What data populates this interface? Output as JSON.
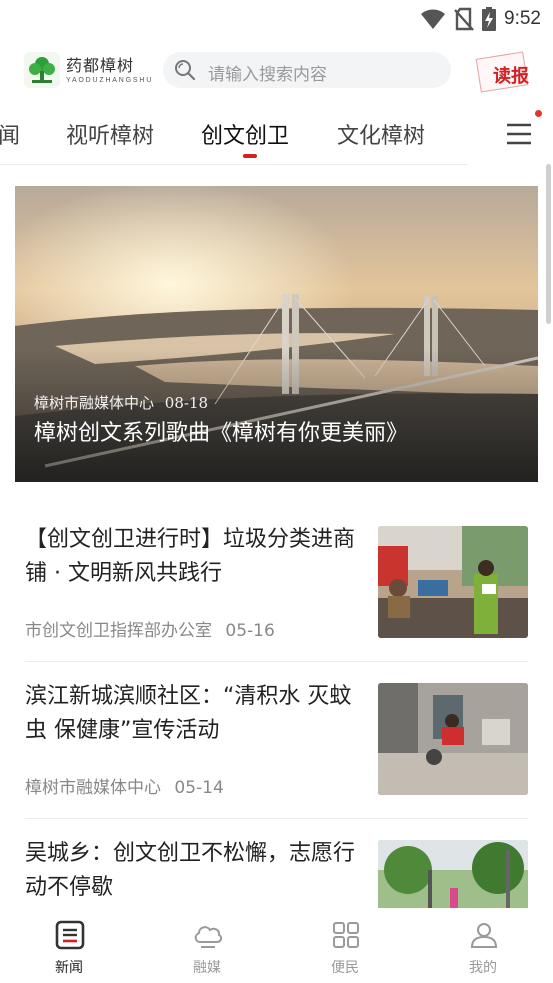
{
  "status_bar": {
    "time": "9:52",
    "icons": [
      "wifi-icon",
      "no-sim-icon",
      "battery-charging-icon"
    ]
  },
  "header": {
    "logo_cn": "药都樟树",
    "logo_en": "YAODUZHANGSHU",
    "search_placeholder": "请输入搜索内容",
    "dubao_label": "读报"
  },
  "tabs": [
    {
      "label": "闻",
      "active": false
    },
    {
      "label": "视听樟树",
      "active": false
    },
    {
      "label": "创文创卫",
      "active": true
    },
    {
      "label": "文化樟树",
      "active": false
    }
  ],
  "hero": {
    "source": "樟树市融媒体中心",
    "date": "08-18",
    "title": "樟树创文系列歌曲《樟树有你更美丽》"
  },
  "news": [
    {
      "title": "【创文创卫进行时】垃圾分类进商铺 · 文明新风共践行",
      "source": "市创文创卫指挥部办公室",
      "date": "05-16"
    },
    {
      "title": "滨江新城滨顺社区：“清积水 灭蚊虫 保健康”宣传活动",
      "source": "樟树市融媒体中心",
      "date": "05-14"
    },
    {
      "title": "吴城乡：创文创卫不松懈，志愿行动不停歇",
      "source": "",
      "date": ""
    }
  ],
  "bottom_nav": [
    {
      "label": "新闻",
      "icon": "news-icon",
      "active": true
    },
    {
      "label": "融媒",
      "icon": "cloud-icon",
      "active": false
    },
    {
      "label": "便民",
      "icon": "grid-icon",
      "active": false
    },
    {
      "label": "我的",
      "icon": "user-icon",
      "active": false
    }
  ],
  "colors": {
    "accent": "#d42020",
    "badge": "#e4332c",
    "text": "#222222",
    "meta": "#888888"
  }
}
